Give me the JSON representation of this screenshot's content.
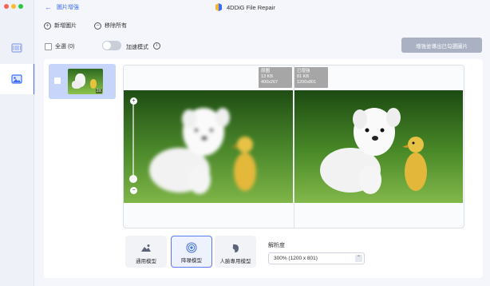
{
  "window": {
    "title": "4DDiG File Repair",
    "back_label": "圖片增強",
    "traffic_colors": [
      "#fe5f57",
      "#febc2e",
      "#28c840"
    ]
  },
  "sidebar": {
    "items": [
      {
        "name": "video-repair",
        "icon": "film-icon",
        "active": false
      },
      {
        "name": "photo-enhance",
        "icon": "image-icon",
        "active": true
      }
    ]
  },
  "toolbar": {
    "add_label": "新增圖片",
    "remove_all_label": "移除所有",
    "select_all_label": "全選 (0)",
    "accelerate_label": "加速模式",
    "export_label": "增強並導出已勾選圖片"
  },
  "thumbnail": {
    "zoom_badge": "2X"
  },
  "preview": {
    "original": {
      "title": "原圖",
      "size": "13 KB",
      "dims": "400x267"
    },
    "enhanced": {
      "title": "已增強",
      "size": "81 KB",
      "dims": "1200x801"
    }
  },
  "models": [
    {
      "label": "通用模型",
      "icon": "landscape-icon",
      "selected": false
    },
    {
      "label": "降噪模型",
      "icon": "denoise-icon",
      "selected": true
    },
    {
      "label": "人臉專用模型",
      "icon": "face-icon",
      "selected": false
    }
  ],
  "resolution": {
    "label": "解析度",
    "value": "300% (1200 x 801)"
  },
  "colors": {
    "accent": "#3d6cf5",
    "export_button": "#a9b1c2"
  }
}
